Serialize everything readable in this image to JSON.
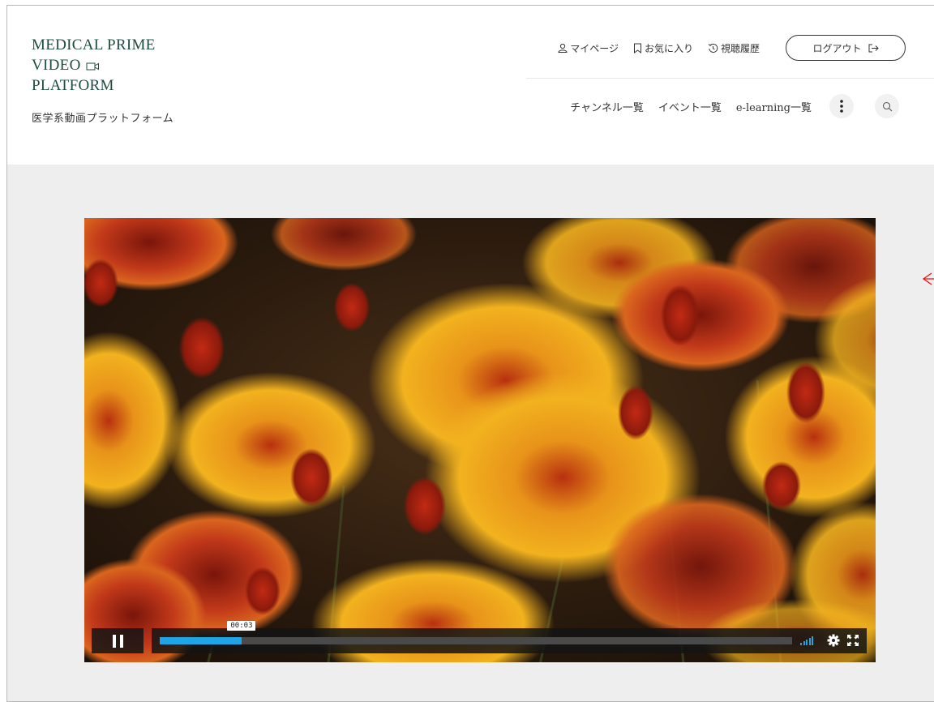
{
  "brand": {
    "line1": "MEDICAL PRIME",
    "line2": "VIDEO",
    "line3": "PLATFORM",
    "subtitle": "医学系動画プラットフォーム",
    "color": "#1e4d3f"
  },
  "top_nav": {
    "mypage": "マイページ",
    "favorites": "お気に入り",
    "history": "視聴履歴",
    "logout": "ログアウト"
  },
  "main_nav": {
    "channels": "チャンネル一覧",
    "events": "イベント一覧",
    "elearning": "e-learning一覧"
  },
  "player": {
    "current_time": "00:03",
    "progress_fraction": 0.13,
    "state": "playing",
    "accent": "#1fa5e6"
  },
  "icons": [
    "user-icon",
    "bookmark-icon",
    "history-icon",
    "logout-icon",
    "more-vertical-icon",
    "search-icon",
    "video-camera-icon",
    "pause-icon",
    "volume-icon",
    "gear-icon",
    "fullscreen-icon"
  ]
}
